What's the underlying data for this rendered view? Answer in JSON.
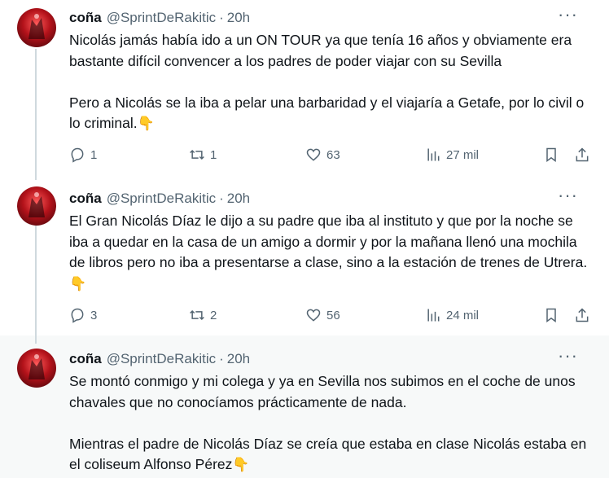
{
  "tweets": [
    {
      "name": "coña",
      "handle": "@SprintDeRakitic",
      "time": "20h",
      "more": "···",
      "text": "Nicolás jamás había ido a un ON TOUR ya que tenía 16 años y obviamente era bastante difícil convencer a los padres de poder viajar con su Sevilla\n\nPero a Nicolás se la iba a pelar una barbaridad y el viajaría a Getafe, por lo civil o lo criminal.",
      "emoji": "👇",
      "replies": "1",
      "retweets": "1",
      "likes": "63",
      "views": "27 mil"
    },
    {
      "name": "coña",
      "handle": "@SprintDeRakitic",
      "time": "20h",
      "more": "···",
      "text": "El Gran Nicolás Díaz le dijo a su padre que iba al instituto y que por la noche se iba a quedar en la casa de un amigo a dormir y por la mañana llenó una mochila de libros pero no iba a presentarse a clase, sino a la estación de trenes de Utrera.",
      "emoji": "👇",
      "replies": "3",
      "retweets": "2",
      "likes": "56",
      "views": "24 mil"
    },
    {
      "name": "coña",
      "handle": "@SprintDeRakitic",
      "time": "20h",
      "more": "···",
      "text": "Se montó conmigo y mi colega y ya en Sevilla nos subimos en el coche de unos chavales que no conocíamos prácticamente de nada.\n\nMientras el padre de Nicolás Díaz se creía que estaba en clase Nicolás estaba en el coliseum Alfonso Pérez",
      "emoji": "👇"
    }
  ],
  "icons": {
    "reply": "reply-icon",
    "retweet": "retweet-icon",
    "like": "heart-icon",
    "views": "views-icon",
    "bookmark": "bookmark-icon",
    "share": "share-icon"
  },
  "colors": {
    "text": "#0f1419",
    "secondary": "#536471",
    "thread_line": "#cfd9de",
    "highlight_bg": "#f7f9f9"
  }
}
